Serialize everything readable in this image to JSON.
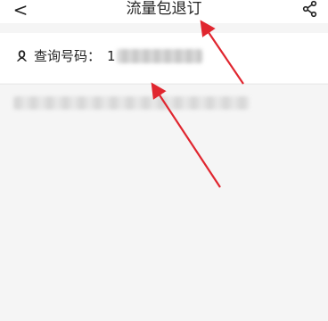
{
  "nav": {
    "back_glyph": "<",
    "title": "流量包退订",
    "share_icon": "share-icon"
  },
  "query": {
    "label": "查询号码：",
    "number_visible_prefix": "1",
    "icon": "user-icon"
  },
  "colors": {
    "annotation_arrow": "#e0262f",
    "background": "#f5f5f5",
    "card": "#ffffff"
  }
}
